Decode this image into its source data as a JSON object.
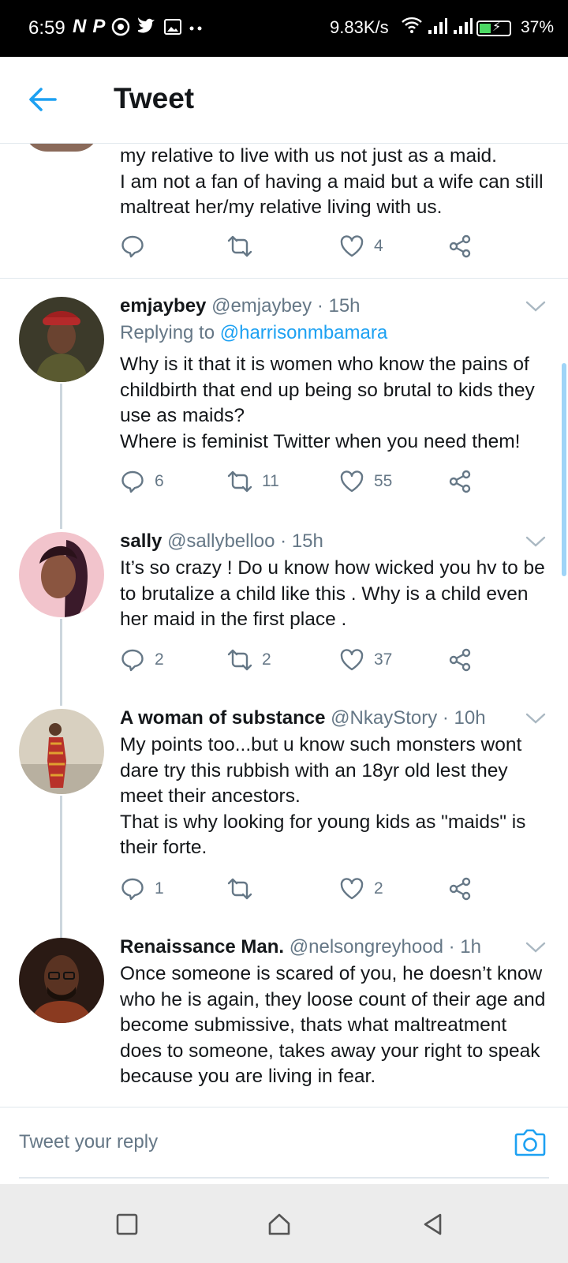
{
  "status": {
    "time": "6:59",
    "notif_icons": [
      "N",
      "P"
    ],
    "net_speed": "9.83K/s",
    "battery": "37%"
  },
  "header": {
    "title": "Tweet"
  },
  "top_tweet": {
    "text": "my relative to live with us not just as a maid.\nI am not a fan of having  a maid but a wife can still maltreat her/my relative living with us.",
    "likes": "4"
  },
  "replies": [
    {
      "name": "emjaybey",
      "handle": "@emjaybey · 15h",
      "replying_prefix": "Replying to ",
      "replying_to": "@harrisonmbamara",
      "text": "Why is it that it is women who know the pains of childbirth that end up being so brutal to kids they use as maids?\nWhere is feminist Twitter when you need them!",
      "replies": "6",
      "retweets": "11",
      "likes": "55"
    },
    {
      "name": "sally",
      "handle": "@sallybelloo · 15h",
      "text": "It’s so crazy ! Do u know how wicked you hv to be to brutalize a child like this . Why is a child even her maid in the first place .",
      "replies": "2",
      "retweets": "2",
      "likes": "37"
    },
    {
      "name": "A woman of substance",
      "handle": "@NkayStory · 10h",
      "text": "My points too...but u know such monsters wont dare try this rubbish with an 18yr old lest they meet their ancestors.\nThat is why looking for young kids as \"maids\" is their forte.",
      "replies": "1",
      "retweets": "",
      "likes": "2"
    },
    {
      "name": "Renaissance Man.",
      "handle": "@nelsongreyhood · 1h",
      "text": "Once someone is scared of you, he doesn’t know who he is again, they loose count of their age and become submissive, thats what maltreatment does to someone, takes away your right to speak because you are living in fear."
    }
  ],
  "reply_bar": {
    "placeholder": "Tweet your reply"
  },
  "colors": {
    "accent": "#1da1f2",
    "muted": "#657786",
    "text": "#14171a"
  }
}
